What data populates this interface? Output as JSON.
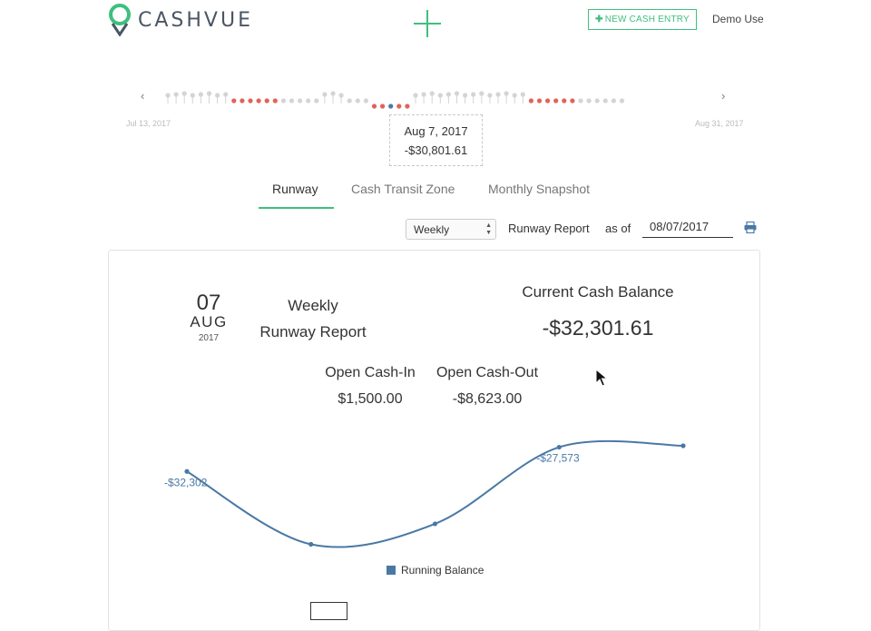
{
  "header": {
    "logo_text": "CASHVUE",
    "new_entry_label": "NEW CASH ENTRY",
    "user_label": "Demo Use"
  },
  "timeline": {
    "start_date": "Jul 13, 2017",
    "end_date": "Aug 31, 2017",
    "tooltip_date": "Aug 7, 2017",
    "tooltip_value": "-$30,801.61"
  },
  "tabs": [
    {
      "label": "Runway",
      "active": true
    },
    {
      "label": "Cash Transit Zone",
      "active": false
    },
    {
      "label": "Monthly Snapshot",
      "active": false
    }
  ],
  "controls": {
    "period_selected": "Weekly",
    "report_label": "Runway Report",
    "as_of_label": "as of",
    "as_of_date": "08/07/2017"
  },
  "report": {
    "day": "07",
    "month": "AUG",
    "year": "2017",
    "title_line1": "Weekly",
    "title_line2": "Runway Report",
    "current_balance_label": "Current Cash Balance",
    "current_balance_value": "-$32,301.61",
    "open_cash_in_label": "Open Cash-In",
    "open_cash_in_value": "$1,500.00",
    "open_cash_out_label": "Open Cash-Out",
    "open_cash_out_value": "-$8,623.00"
  },
  "chart_data": {
    "type": "line",
    "series": [
      {
        "name": "Running Balance",
        "values": [
          -32302,
          -46500,
          -42500,
          -27573,
          -27300
        ]
      }
    ],
    "point_labels": [
      "-$32,302",
      "",
      "",
      "-$27,573",
      ""
    ],
    "ylim": [
      -48000,
      -25000
    ],
    "legend_position": "bottom",
    "grid": false
  },
  "colors": {
    "accent": "#3fbf7f",
    "line": "#4a78a5",
    "negative_dot": "#e0635a",
    "neutral_dot": "#d4d4d4"
  }
}
